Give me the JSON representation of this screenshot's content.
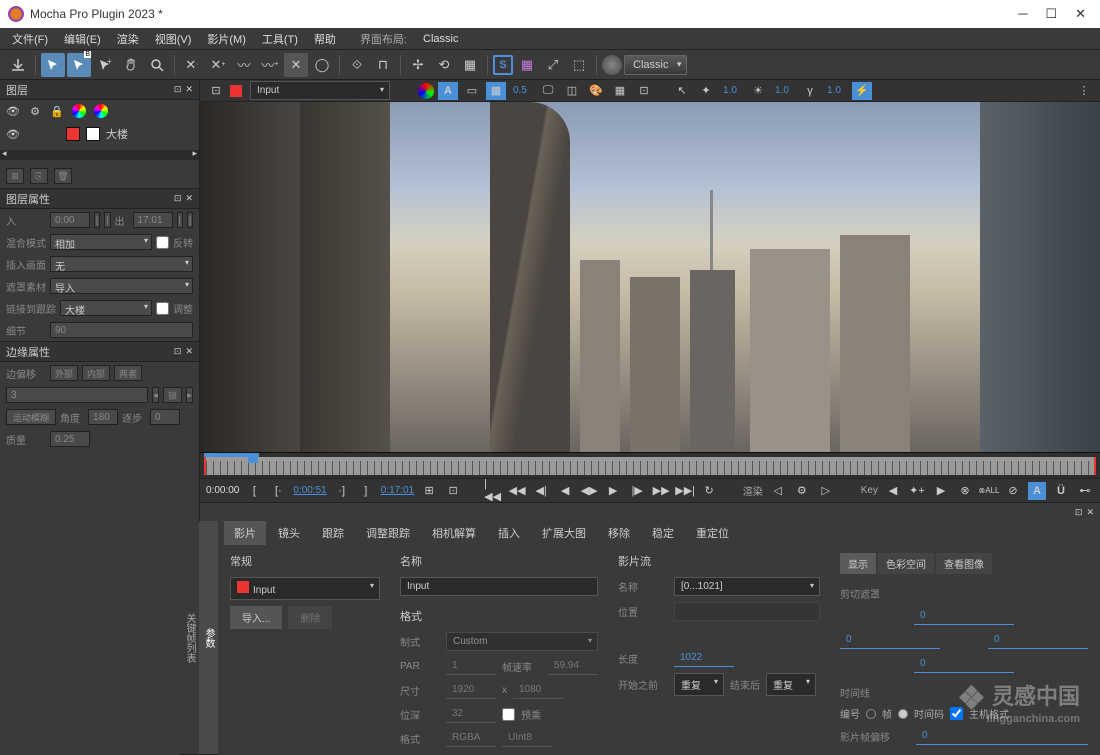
{
  "titlebar": {
    "title": "Mocha Pro Plugin 2023 *"
  },
  "menubar": {
    "items": [
      "文件(F)",
      "编辑(E)",
      "渲染",
      "视图(V)",
      "影片(M)",
      "工具(T)",
      "帮助"
    ],
    "layout_label": "界面布局:",
    "layout_value": "Classic"
  },
  "toolbar": {
    "mode": "Classic"
  },
  "left": {
    "layers_title": "图层",
    "layer_name": "大楼",
    "layer_props_title": "图层属性",
    "in_label": "入",
    "in_val": "0:00",
    "out_label": "出",
    "out_val": "17:01",
    "blend_label": "混合模式",
    "blend_val": "相加",
    "invert_label": "反转",
    "insert_label": "插入画面",
    "insert_val": "无",
    "mask_src_label": "遮罩素材",
    "mask_src_val": "导入",
    "link_label": "链接到跟踪",
    "link_val": "大楼",
    "adjust_label": "调整",
    "detail_label": "细节",
    "detail_val": "90",
    "edge_title": "边缘属性",
    "edge_offset_label": "边偏移",
    "edge_b1": "外部",
    "edge_b2": "内部",
    "edge_b3": "两者",
    "edge_val": "3",
    "lock_label": "锁",
    "motion_blur": "运动模糊",
    "angle_label": "角度",
    "angle_val": "180",
    "phase_label": "逐步",
    "phase_val": "0",
    "quality_label": "质量",
    "quality_val": "0.25"
  },
  "viewer": {
    "input_label": "Input",
    "zoom1": "0.5",
    "zoom2": "1.0",
    "zoom3": "1.0"
  },
  "transport": {
    "tc_start": "0:00:00",
    "tc_in": "0:00:51",
    "tc_out": "0:17:01",
    "render_label": "渲染",
    "key_label": "Key",
    "all_label": "ALL"
  },
  "bottom": {
    "side_tabs": [
      "参数",
      "关键帧列表"
    ],
    "tabs": [
      "影片",
      "镜头",
      "跟踪",
      "调整跟踪",
      "相机解算",
      "插入",
      "扩展大图",
      "移除",
      "稳定",
      "重定位"
    ],
    "col1": {
      "header": "常规",
      "input_val": "Input",
      "import_btn": "导入...",
      "del_btn": "删除"
    },
    "col2": {
      "name_label": "名称",
      "name_val": "Input",
      "format_label": "格式",
      "std_label": "制式",
      "std_val": "Custom",
      "par_label": "PAR",
      "par_val": "1",
      "fps_label": "帧速率",
      "fps_val": "59.94",
      "size_label": "尺寸",
      "size_w": "1920",
      "size_x": "x",
      "size_h": "1080",
      "depth_label": "位深",
      "depth_val": "32",
      "premult_label": "预乘",
      "fmt_label": "格式",
      "fmt_val": "RGBA",
      "fmt_bits": "UInt8"
    },
    "col3": {
      "stream_label": "影片流",
      "name_label": "名称",
      "name_val": "[0...1021]",
      "path_label": "位置",
      "length_label": "长度",
      "length_val": "1022",
      "before_label": "开始之前",
      "before_val": "重复",
      "after_label": "结束后",
      "after_val": "重复"
    },
    "col4": {
      "display_tab": "显示",
      "color_tab": "色彩空间",
      "view_tab": "查看图像",
      "crop_label": "剪切遮罩",
      "zero": "0",
      "timeline_label": "时间线",
      "number_label": "编号",
      "frame_label": "帧",
      "tc_label": "时间码",
      "host_label": "主机格式",
      "clip_offset_label": "影片帧偏移",
      "clip_offset_val": "0"
    }
  },
  "watermark": {
    "text": "灵感中国",
    "sub": "lingganchina.com"
  }
}
